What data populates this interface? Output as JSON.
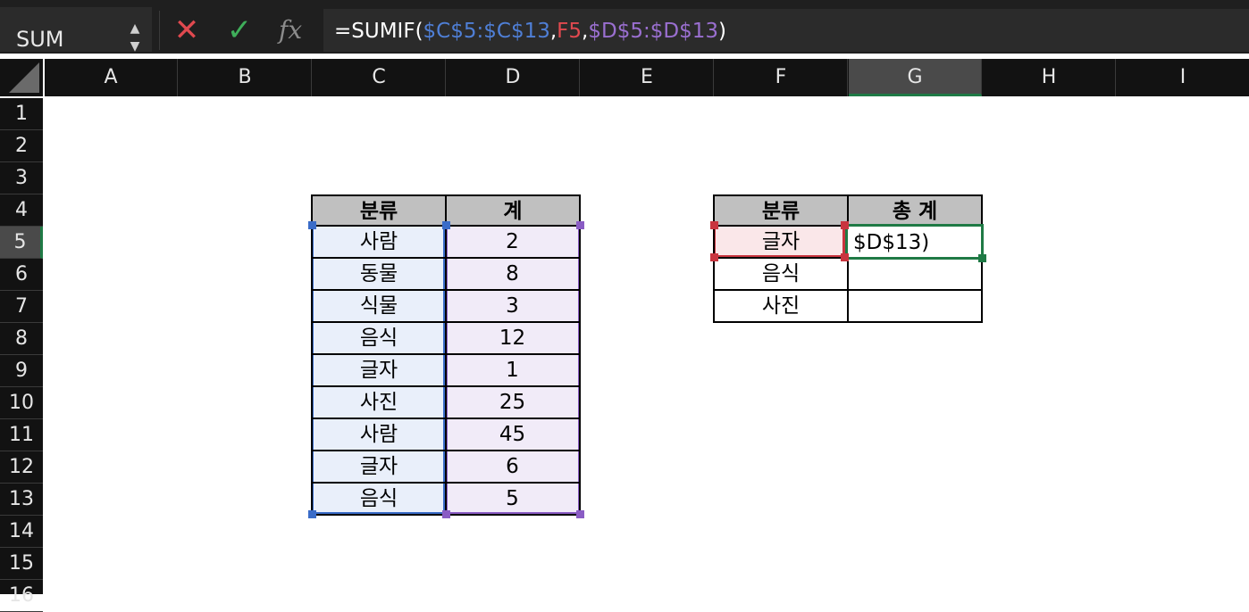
{
  "formula_bar": {
    "name_box": "SUM",
    "name_box_arrows": "▲\n▼",
    "cancel_icon": "✕",
    "enter_icon": "✓",
    "fx_label": "fx",
    "formula": {
      "prefix": "=SUMIF(",
      "ref1": "$C$5:$C$13",
      "sep1": ",",
      "ref2": "F5",
      "sep2": ",",
      "ref3": "$D$5:$D$13",
      "suffix": ")"
    }
  },
  "columns": [
    "A",
    "B",
    "C",
    "D",
    "E",
    "F",
    "G",
    "H",
    "I"
  ],
  "active_column": "G",
  "rows": [
    "1",
    "2",
    "3",
    "4",
    "5",
    "6",
    "7",
    "8",
    "9",
    "10",
    "11",
    "12",
    "13",
    "14",
    "15",
    "16"
  ],
  "active_row": "5",
  "source_table": {
    "headers": [
      "분류",
      "계"
    ],
    "rows": [
      [
        "사람",
        "2"
      ],
      [
        "동물",
        "8"
      ],
      [
        "식물",
        "3"
      ],
      [
        "음식",
        "12"
      ],
      [
        "글자",
        "1"
      ],
      [
        "사진",
        "25"
      ],
      [
        "사람",
        "45"
      ],
      [
        "글자",
        "6"
      ],
      [
        "음식",
        "5"
      ]
    ]
  },
  "summary_table": {
    "headers": [
      "분류",
      "총 계"
    ],
    "rows": [
      [
        "글자",
        "$D$13)"
      ],
      [
        "음식",
        ""
      ],
      [
        "사진",
        ""
      ]
    ]
  },
  "colors": {
    "range_c": "#3a6cc8",
    "range_d": "#8a5cc4",
    "criteria": "#c9353f",
    "active": "#1f7a45"
  }
}
